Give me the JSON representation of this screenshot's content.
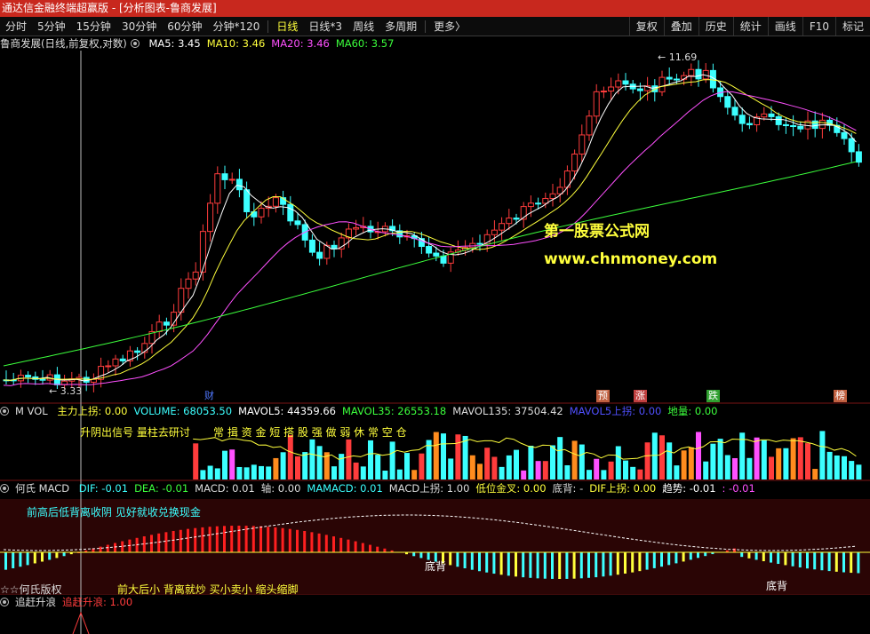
{
  "window": {
    "title": "通达信金融终端超赢版 - [分析图表-鲁商发展]"
  },
  "toolbar": {
    "periods": [
      {
        "label": "分时",
        "active": false
      },
      {
        "label": "5分钟",
        "active": false
      },
      {
        "label": "15分钟",
        "active": false
      },
      {
        "label": "30分钟",
        "active": false
      },
      {
        "label": "60分钟",
        "active": false
      },
      {
        "label": "分钟*120",
        "active": false
      },
      {
        "label": "日线",
        "active": true
      },
      {
        "label": "日线*3",
        "active": false
      },
      {
        "label": "周线",
        "active": false
      },
      {
        "label": "多周期",
        "active": false
      },
      {
        "label": "更多〉",
        "active": false
      }
    ],
    "tools": [
      "复权",
      "叠加",
      "历史",
      "统计",
      "画线",
      "F10",
      "标记"
    ]
  },
  "main_panel": {
    "stock_label": "鲁商发展(日线,前复权,对数)",
    "indicators": [
      {
        "label": "MA5: 3.45",
        "color": "#ffffff"
      },
      {
        "label": "MA10: 3.46",
        "color": "#ffff3c"
      },
      {
        "label": "MA20: 3.46",
        "color": "#ff50ff"
      },
      {
        "label": "MA60: 3.57",
        "color": "#3cff3c"
      }
    ],
    "high_label": "11.69",
    "low_label": "3.33",
    "watermark_line1": "第一股票公式网",
    "watermark_line2": "www.chnmoney.com",
    "event_flags": [
      {
        "label": "财",
        "color": "#5078ff"
      },
      {
        "label": "预",
        "color": "#c06040"
      },
      {
        "label": "涨",
        "color": "#c04040"
      },
      {
        "label": "跌",
        "color": "#30a030"
      },
      {
        "label": "榜",
        "color": "#c06040"
      }
    ]
  },
  "vol_panel": {
    "name": "M VOL",
    "indicators": [
      {
        "label": "主力上拐: 0.00",
        "color": "#ffff3c"
      },
      {
        "label": "VOLUME: 68053.50",
        "color": "#3cffff"
      },
      {
        "label": "MAVOL5: 44359.66",
        "color": "#ffffff"
      },
      {
        "label": "MAVOL35: 26553.18",
        "color": "#3cff3c"
      },
      {
        "label": "MAVOL135: 37504.42",
        "color": "#dddddd"
      },
      {
        "label": "MAVOL5上拐: 0.00",
        "color": "#5050ff"
      },
      {
        "label": "地量: 0.00",
        "color": "#3cff3c"
      }
    ],
    "note_left": "升阴出信号  量柱去研讨",
    "note_right": "常 揖 资 金 短 搭 股  强 做 弱 休 常 空 仓"
  },
  "macd_panel": {
    "name": "何氏 MACD",
    "indicators": [
      {
        "label": "DIF: -0.01",
        "color": "#3cffff"
      },
      {
        "label": "DEA: -0.01",
        "color": "#3cff3c"
      },
      {
        "label": "MACD: 0.01",
        "color": "#dddddd"
      },
      {
        "label": "轴: 0.00",
        "color": "#dddddd"
      },
      {
        "label": "MAMACD: 0.01",
        "color": "#3cffff"
      },
      {
        "label": "MACD上拐: 1.00",
        "color": "#dddddd"
      },
      {
        "label": "低位金叉: 0.00",
        "color": "#ffff3c"
      },
      {
        "label": "底背: -",
        "color": "#dddddd"
      },
      {
        "label": "DIF上拐: 0.00",
        "color": "#ffff3c"
      },
      {
        "label": "趋势: -0.01",
        "color": "#ffffff"
      },
      {
        "label": ": -0.01",
        "color": "#ff50ff"
      }
    ],
    "note_top": "前高后低背离收阴   见好就收兑换现金",
    "bottom_left": "☆☆何氏版权",
    "bottom_mid": "前大后小   背离就炒     买小卖小   缩头缩脚",
    "divergence_label": "底背"
  },
  "chase_panel": {
    "name": "追赶升浪",
    "value": "追赶升浪: 1.00"
  }
}
